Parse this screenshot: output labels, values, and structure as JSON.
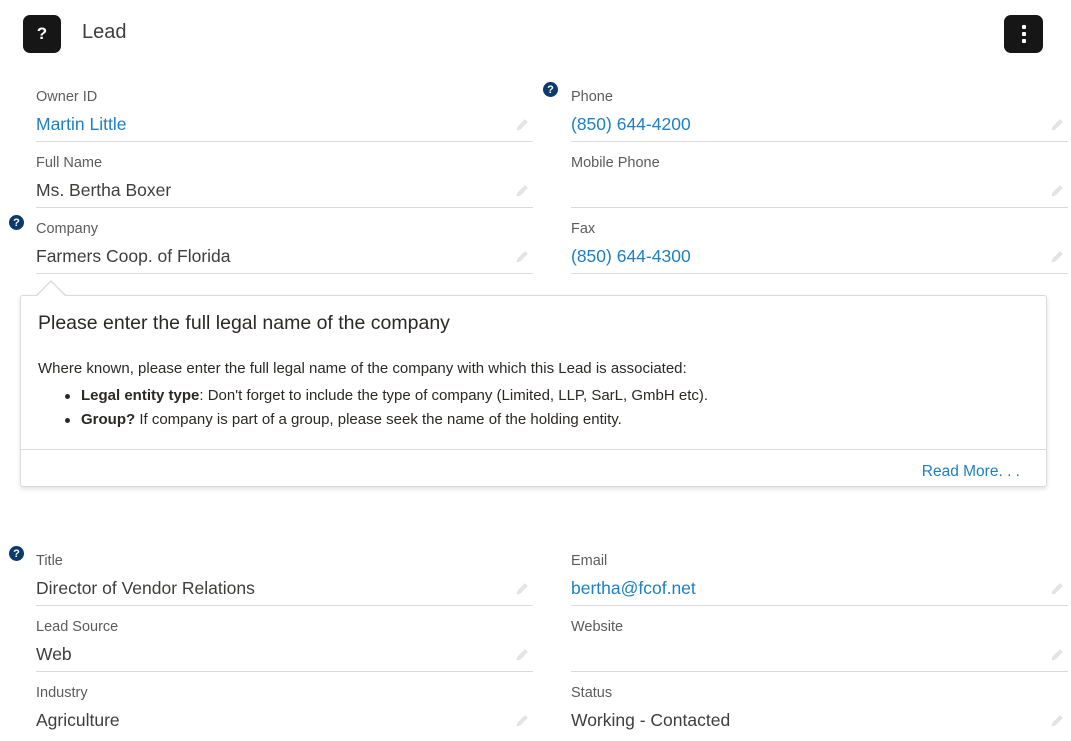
{
  "header": {
    "badge_glyph": "?",
    "title": "Lead",
    "menu_icon": "more-vertical-icon"
  },
  "fields": {
    "owner_id": {
      "label": "Owner ID",
      "value": "Martin Little"
    },
    "phone": {
      "label": "Phone",
      "value": "(850) 644-4200"
    },
    "full_name": {
      "label": "Full Name",
      "value": "Ms. Bertha Boxer"
    },
    "mobile_phone": {
      "label": "Mobile Phone",
      "value": ""
    },
    "company": {
      "label": "Company",
      "value": "Farmers Coop. of Florida"
    },
    "fax": {
      "label": "Fax",
      "value": "(850) 644-4300"
    },
    "title": {
      "label": "Title",
      "value": "Director of Vendor Relations"
    },
    "email": {
      "label": "Email",
      "value": "bertha@fcof.net"
    },
    "lead_source": {
      "label": "Lead Source",
      "value": "Web"
    },
    "website": {
      "label": "Website",
      "value": ""
    },
    "industry": {
      "label": "Industry",
      "value": "Agriculture"
    },
    "status": {
      "label": "Status",
      "value": "Working - Contacted"
    }
  },
  "help_glyph": "?",
  "popover": {
    "title": "Please enter the full legal name of the company",
    "intro": "Where known, please enter the full legal name of the company with which this Lead is associated:",
    "items": [
      {
        "bold": "Legal entity type",
        "text": ": Don't forget to include the type of company (Limited, LLP, SarL, GmbH etc)."
      },
      {
        "bold": "Group?",
        "text": " If company is part of a group, please seek the name of the holding entity."
      }
    ],
    "read_more": "Read More. . ."
  },
  "colors": {
    "link": "#1c7fc7",
    "help_icon": "#0c3a6b",
    "badge_bg": "#161616",
    "divider": "#dddbda"
  }
}
